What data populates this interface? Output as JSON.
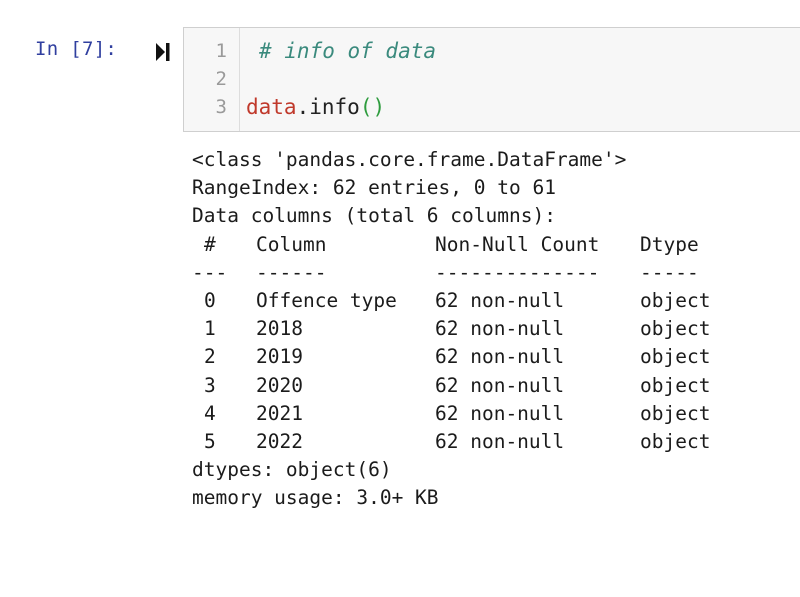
{
  "cell": {
    "prompt": "In [7]:",
    "line_numbers": [
      "1",
      "2",
      "3"
    ],
    "code": {
      "comment": "# info of data",
      "object": "data",
      "dot": ".",
      "method": "info",
      "parens": "()"
    }
  },
  "output": {
    "class_line": "<class 'pandas.core.frame.DataFrame'>",
    "range_index": "RangeIndex: 62 entries, 0 to 61",
    "columns_summary": "Data columns (total 6 columns):",
    "headers": [
      "#",
      "Column",
      "Non-Null Count",
      "Dtype"
    ],
    "separators": [
      "---",
      "------",
      "--------------",
      "-----"
    ],
    "rows": [
      [
        "0",
        "Offence type",
        "62 non-null",
        "object"
      ],
      [
        "1",
        "2018",
        "62 non-null",
        "object"
      ],
      [
        "2",
        "2019",
        "62 non-null",
        "object"
      ],
      [
        "3",
        "2020",
        "62 non-null",
        "object"
      ],
      [
        "4",
        "2021",
        "62 non-null",
        "object"
      ],
      [
        "5",
        "2022",
        "62 non-null",
        "object"
      ]
    ],
    "dtypes_line": "dtypes: object(6)",
    "memory_line": "memory usage: 3.0+ KB"
  },
  "colors": {
    "prompt": "#303f9f",
    "comment": "#3a8a7d",
    "variable": "#c0392b",
    "paren": "#2e9c3e"
  }
}
